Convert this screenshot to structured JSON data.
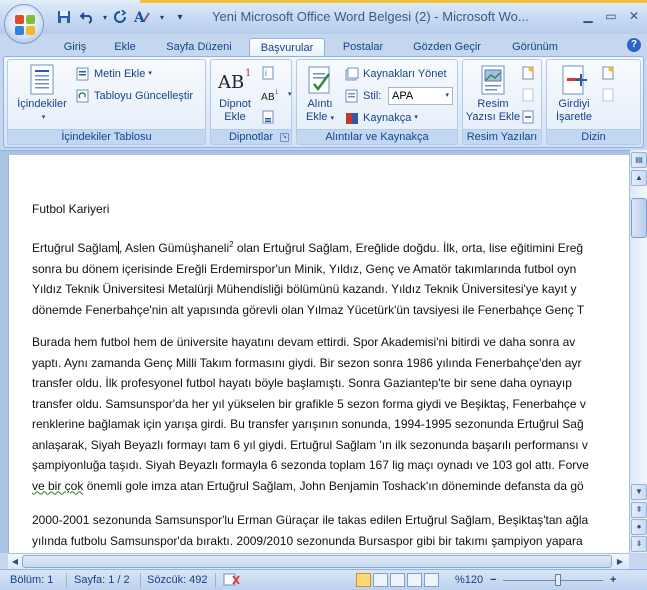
{
  "window": {
    "title": "Yeni Microsoft Office Word Belgesi (2) - Microsoft Wo..."
  },
  "quick_access": {
    "save_icon": "save-icon",
    "undo_icon": "undo-icon",
    "redo_icon": "redo-icon",
    "format_icon": "text-format-icon",
    "customize_glyph": "▾"
  },
  "tabs": [
    {
      "label": "Giriş"
    },
    {
      "label": "Ekle"
    },
    {
      "label": "Sayfa Düzeni"
    },
    {
      "label": "Başvurular",
      "active": true
    },
    {
      "label": "Postalar"
    },
    {
      "label": "Gözden Geçir"
    },
    {
      "label": "Görünüm"
    }
  ],
  "ribbon": {
    "toc_group": {
      "label": "İçindekiler Tablosu",
      "toc_button": "İçindekiler",
      "add_text": "Metin Ekle",
      "update_table": "Tabloyu Güncelleştir"
    },
    "footnotes_group": {
      "label": "Dipnotlar",
      "insert_footnote_line1": "Dipnot",
      "insert_footnote_line2": "Ekle",
      "icon_text": "AB",
      "icon_sup": "1",
      "small_icon_text": "AB"
    },
    "citations_group": {
      "label": "Alıntılar ve Kaynakça",
      "insert_citation_line1": "Alıntı",
      "insert_citation_line2": "Ekle",
      "manage_sources": "Kaynakları Yönet",
      "style_label": "Stil:",
      "style_value": "APA",
      "bibliography": "Kaynakça"
    },
    "captions_group": {
      "label": "Resim Yazıları",
      "insert_caption_line1": "Resim",
      "insert_caption_line2": "Yazısı Ekle"
    },
    "index_group": {
      "label": "Dizin",
      "mark_entry_line1": "Girdiyi",
      "mark_entry_line2": "İşaretle"
    }
  },
  "document": {
    "heading": "Futbol Kariyeri",
    "p1": [
      {
        "a": "Ertuğrul Sağlam",
        "b": ", Aslen Gümüşhaneli",
        "sup": "2",
        "c": "  olan Ertuğrul Sağlam, Ereğlide doğdu. İlk, orta, lise eğitimini Ereğ"
      },
      "sonra bu dönem  içerisinde Ereğli Erdemirspor'un Minik, Yıldız, Genç ve Amatör takımlarında  futbol oyn",
      "Yıldız Teknik Üniversitesi Metalürji Mühendisliği bölümünü kazandı.  Yıldız Teknik Üniversitesi'ye kayıt y",
      "dönemde Fenerbahçe'nin  alt yapısında görevli olan Yılmaz Yücetürk'ün tavsiyesi ile Fenerbahçe  Genç T"
    ],
    "p2": [
      "Burada hem futbol  hem de üniversite hayatını devam ettirdi. Spor Akademisi'ni  bitirdi ve daha sonra av",
      "yaptı. Aynı zamanda Genç Milli Takım formasını giydi. Bir sezon sonra 1986 yılında Fenerbahçe'den  ayr",
      "transfer oldu. İlk profesyonel  futbol hayatı böyle başlamıştı. Sonra Gaziantep'te bir sene daha oynayıp",
      "transfer oldu. Samsunspor'da her yıl yükselen bir grafikle 5 sezon forma giydi ve Beşiktaş, Fenerbahçe v",
      "renklerine bağlamak için yarışa girdi. Bu transfer yarışının sonunda, 1994-1995 sezonunda Ertuğrul Sağ",
      "anlaşarak, Siyah  Beyazlı formayı  tam 6 yıl giydi. Ertuğrul Sağlam 'ın ilk sezonunda başarılı performansı v",
      "şampiyonluğa taşıdı. Siyah Beyazlı formayla 6 sezonda toplam 167 lig maçı oynadı ve 103 gol attı. Forve",
      {
        "squig": "ve bir çok",
        "rest": " önemli  gole imza atan Ertuğrul Sağlam, John Benjamin Toshack'ın döneminde  defansta da gö"
      }
    ],
    "p3": [
      "2000-2001 sezonunda Samsunspor'lu  Erman Güraçar ile takas edilen Ertuğrul Sağlam, Beşiktaş'tan ağla",
      "yılında futbolu Samsunspor'da bıraktı. 2009/2010 sezonunda Bursaspor gibi bir takımı şampiyon yapara"
    ]
  },
  "statusbar": {
    "section": "Bölüm: 1",
    "page": "Sayfa: 1 / 2",
    "words": "Sözcük: 492",
    "zoom": "%120",
    "zoom_minus": "−",
    "zoom_plus": "+"
  },
  "colors": {
    "ribbon_text": "#15428b",
    "window_bg": "#c5d7ef",
    "page_bg": "#ffffff"
  }
}
